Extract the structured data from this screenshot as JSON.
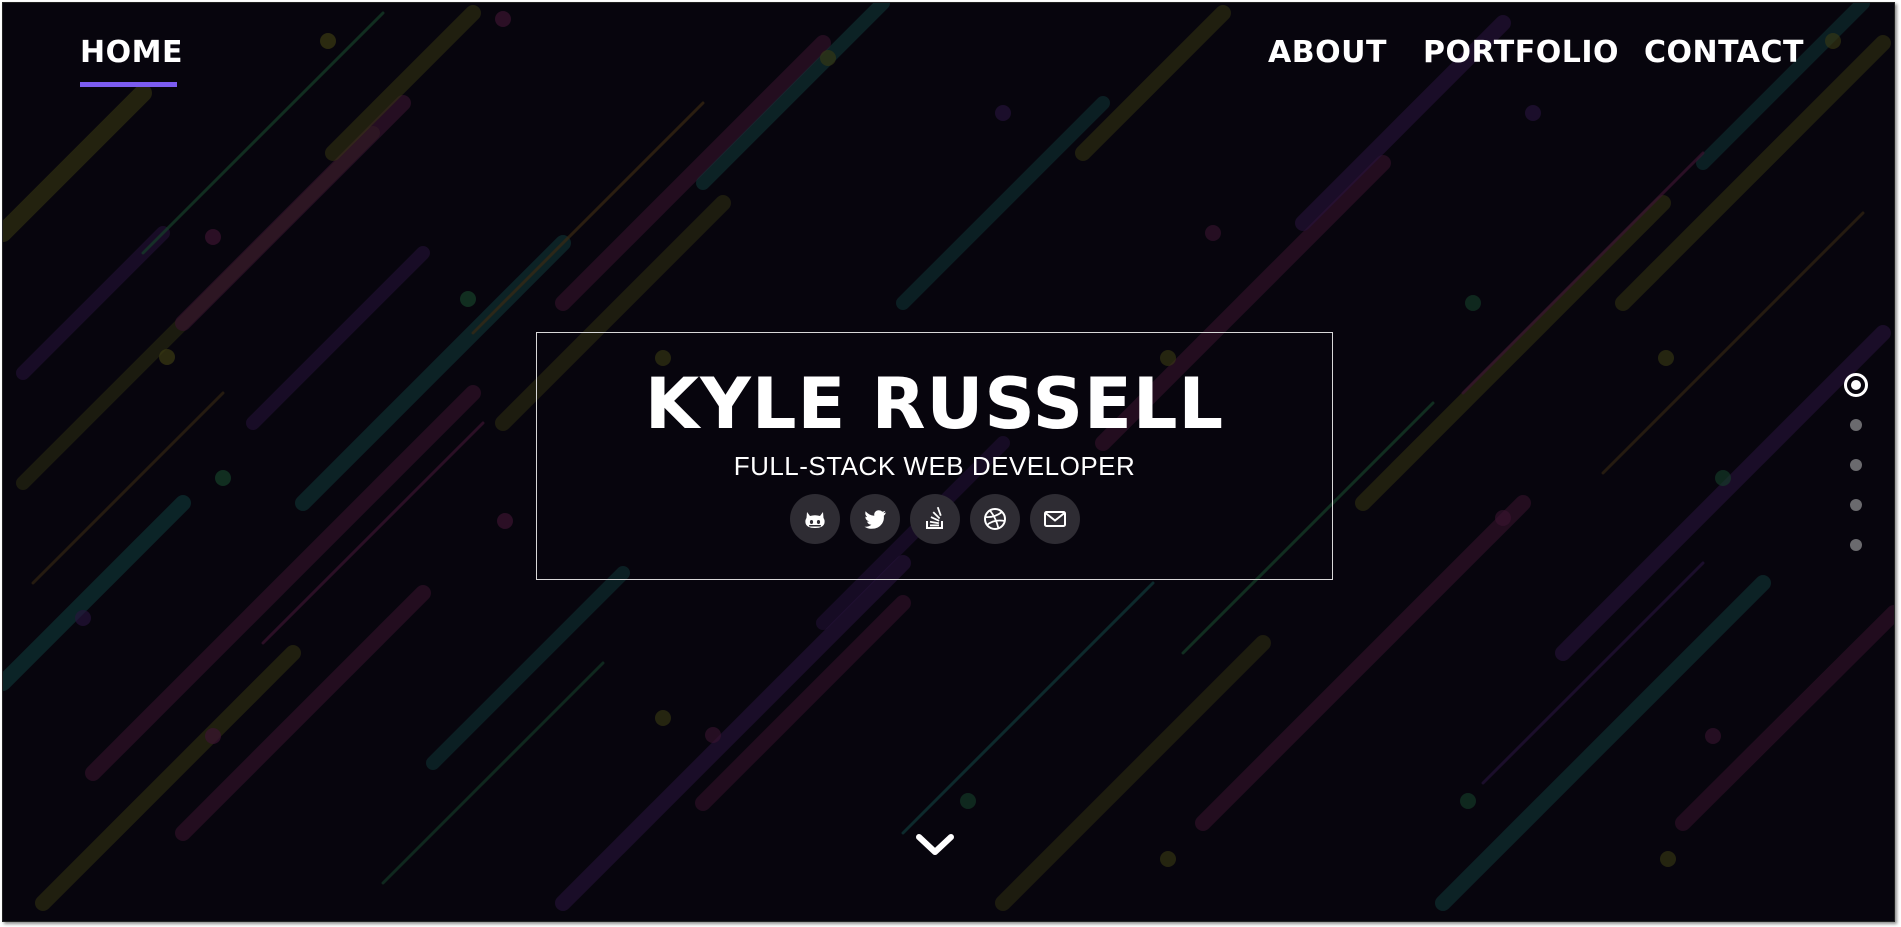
{
  "nav": {
    "home": "HOME",
    "about": "ABOUT",
    "portfolio": "PORTFOLIO",
    "contact": "CONTACT",
    "active": "HOME"
  },
  "hero": {
    "name": "KYLE RUSSELL",
    "subtitle": "FULL-STACK WEB DEVELOPER"
  },
  "socials": [
    {
      "icon": "github-icon"
    },
    {
      "icon": "twitter-icon"
    },
    {
      "icon": "stackoverflow-icon"
    },
    {
      "icon": "dribbble-icon"
    },
    {
      "icon": "email-icon"
    }
  ],
  "section_dots": {
    "count": 5,
    "active_index": 0
  },
  "colors": {
    "background": "#07050d",
    "accent": "#7c5cf0",
    "text": "#ffffff",
    "icon_circle": "#2e2c33"
  }
}
